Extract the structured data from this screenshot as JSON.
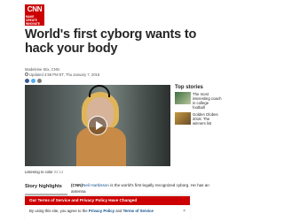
{
  "header": {
    "logo_text": "CNN",
    "section_label": "MAKE CREATE INNOVATE",
    "brand_color": "#cc0000"
  },
  "article": {
    "headline": "World's first cyborg wants to hack your body",
    "byline": "Madeleine Stix, CNN",
    "updated": "Updated 4:58 PM ET, Thu January 7, 2016",
    "video_caption": "Listening to color",
    "video_duration": "02:14",
    "highlights_title": "Story highlights",
    "body_lead": "(CNN)",
    "body_link": "Neil Harbisson",
    "body_text": " is the world's first legally recognized cyborg. He has an antenna"
  },
  "right_rail": {
    "title": "Top stories",
    "stories": [
      {
        "text": "The most interesting coach in college football"
      },
      {
        "text": "Golden Globes 2016: The winners list"
      }
    ]
  },
  "banner": {
    "title": "Our Terms of Service and Privacy Policy Have Changed",
    "message_prefix": "By using this site, you agree to the ",
    "privacy_link": "Privacy Policy",
    "message_and": " and ",
    "terms_link": "Terms of Service",
    "close_symbol": "×"
  },
  "icons": [
    "clock-icon",
    "facebook-icon",
    "twitter-icon",
    "email-icon",
    "play-icon",
    "close-icon"
  ]
}
